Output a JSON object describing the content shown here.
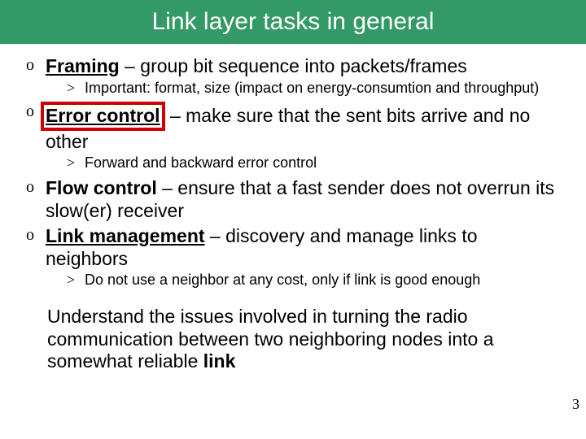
{
  "title": "Link layer tasks in general",
  "bullets": [
    {
      "term": "Framing",
      "rest": " – group bit sequence into packets/frames",
      "sub": [
        "Important: format, size (impact on energy-consumtion and throughput)"
      ]
    },
    {
      "term": "Error control",
      "rest": " – make sure that the sent bits arrive and no other",
      "highlight": true,
      "sub": [
        "Forward and backward error control"
      ]
    },
    {
      "term": "Flow control",
      "rest": " – ensure that a fast sender does not overrun its slow(er) receiver",
      "sub": []
    },
    {
      "term": "Link management",
      "rest": " – discovery and manage links to neighbors",
      "sub": [
        "Do not use a neighbor at any cost, only if link is good enough"
      ]
    }
  ],
  "summary_pre": "Understand the issues involved in turning the radio communication between two neighboring nodes into a somewhat reliable ",
  "summary_bold": "link",
  "page_number": "3"
}
